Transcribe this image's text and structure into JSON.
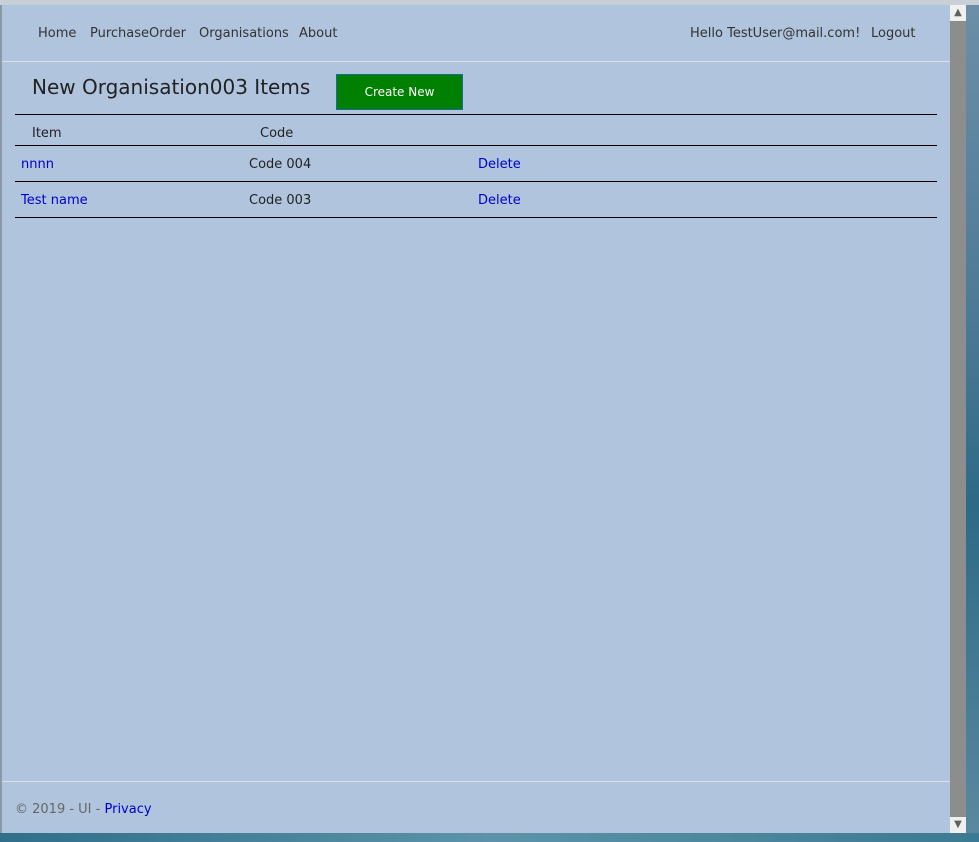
{
  "nav": {
    "home": "Home",
    "purchase_order": "PurchaseOrder",
    "organisations": "Organisations",
    "about": "About",
    "greeting": "Hello TestUser@mail.com!",
    "logout": "Logout"
  },
  "page": {
    "title": "New Organisation003 Items",
    "create_button": "Create New"
  },
  "table": {
    "headers": [
      "Item",
      "Code"
    ],
    "rows": [
      {
        "item": "nnnn",
        "code": "Code 004",
        "action": "Delete"
      },
      {
        "item": "Test name",
        "code": "Code 003",
        "action": "Delete"
      }
    ]
  },
  "footer": {
    "copyright": "© 2019 - UI - ",
    "privacy": "Privacy"
  },
  "scrollbar": {
    "up_icon": "chevron-up-icon",
    "down_icon": "chevron-down-icon"
  },
  "colors": {
    "page_background": "#b0c4de",
    "button_green": "#008000",
    "link_blue": "#0000cc"
  }
}
